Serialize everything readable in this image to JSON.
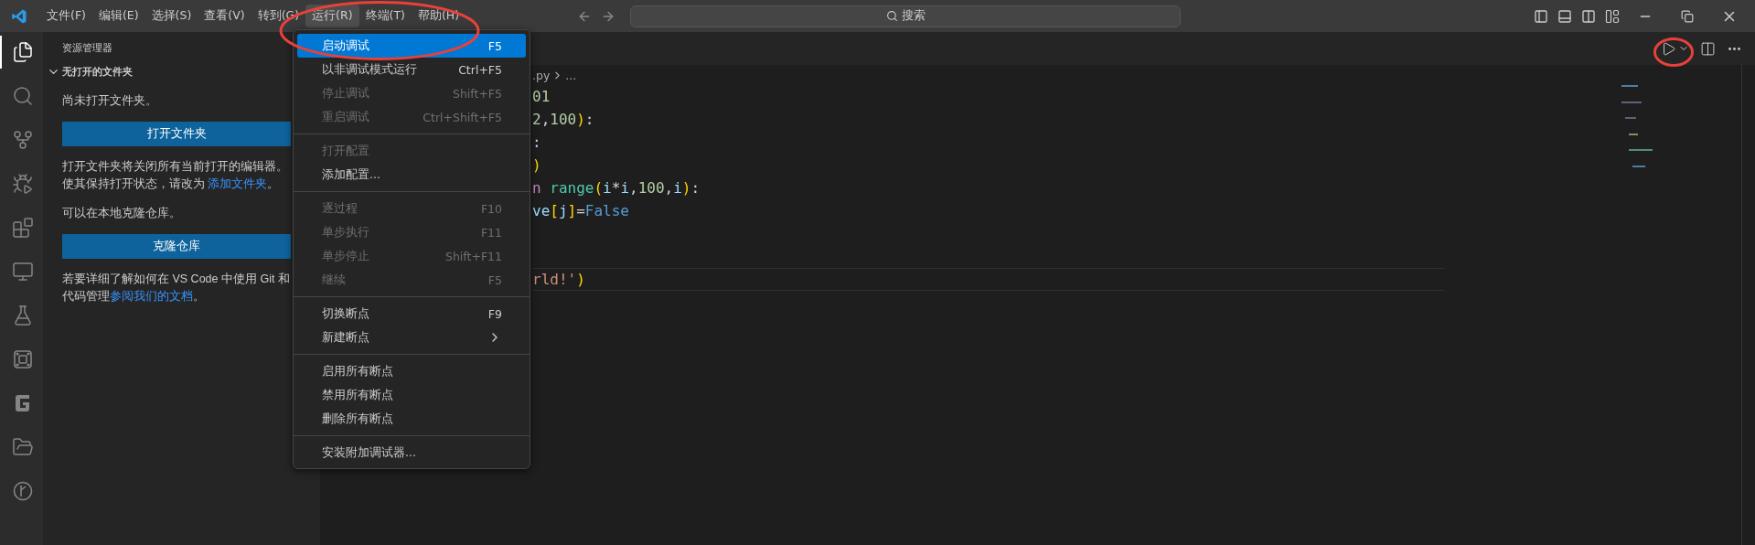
{
  "title_bar": {
    "menus": [
      {
        "label": "文件(F)",
        "selected": false
      },
      {
        "label": "编辑(E)",
        "selected": false
      },
      {
        "label": "选择(S)",
        "selected": false
      },
      {
        "label": "查看(V)",
        "selected": false
      },
      {
        "label": "转到(G)",
        "selected": false
      },
      {
        "label": "运行(R)",
        "selected": true
      },
      {
        "label": "终端(T)",
        "selected": false
      },
      {
        "label": "帮助(H)",
        "selected": false
      }
    ],
    "search": {
      "placeholder": "搜索"
    }
  },
  "activity_bar": {
    "items": [
      {
        "kind": "explorer",
        "selected": true
      },
      {
        "kind": "search",
        "selected": false
      },
      {
        "kind": "source_control",
        "selected": false
      },
      {
        "kind": "run_debug",
        "selected": false
      },
      {
        "kind": "extensions",
        "selected": false
      },
      {
        "kind": "remote",
        "selected": false
      },
      {
        "kind": "testing",
        "selected": false
      },
      {
        "kind": "box",
        "selected": false
      },
      {
        "kind": "g",
        "selected": false
      },
      {
        "kind": "folder",
        "selected": false
      },
      {
        "kind": "git_graph",
        "selected": false
      }
    ]
  },
  "sidebar": {
    "title": "资源管理器",
    "section": {
      "label": "无打开的文件夹",
      "expanded": true
    },
    "empty_text": "尚未打开文件夹。",
    "open_button": "打开文件夹",
    "open_note": {
      "lines": [
        "打开文件夹将关闭所有当前打开的编辑器。",
        "使其保持打开状态，请改为 "
      ],
      "link": "添加文件夹",
      "after": "。"
    },
    "clone_text": "可以在本地克隆仓库。",
    "clone_button": "克隆仓库",
    "git_note": {
      "lines": [
        "若要详细了解如何在 VS Code 中使用 Git 和",
        "代码管理"
      ],
      "link": "参阅我们的文档",
      "after": "。"
    }
  },
  "editor": {
    "breadcrumb": {
      "file": ".py",
      "rest": "..."
    },
    "lines": [
      {
        "current": false,
        "tokens": [
          {
            "text": "01",
            "kind": "number"
          }
        ]
      },
      {
        "current": false,
        "tokens": [
          {
            "text": "2",
            "kind": "number"
          },
          {
            "text": ",",
            "kind": "plain"
          },
          {
            "text": "100",
            "kind": "number"
          },
          {
            "text": ")",
            "kind": "bracket"
          },
          {
            "text": ":",
            "kind": "plain"
          }
        ]
      },
      {
        "current": false,
        "tokens": [
          {
            "text": ":",
            "kind": "plain"
          }
        ]
      },
      {
        "current": false,
        "tokens": [
          {
            "text": ")",
            "kind": "bracket"
          }
        ]
      },
      {
        "current": false,
        "tokens": [
          {
            "text": "n",
            "kind": "keyword"
          },
          {
            "kind": "space"
          },
          {
            "text": "range",
            "kind": "function"
          },
          {
            "text": "(",
            "kind": "bracket"
          },
          {
            "text": "i",
            "kind": "variable"
          },
          {
            "text": "*",
            "kind": "plain"
          },
          {
            "text": "i",
            "kind": "variable"
          },
          {
            "text": ",",
            "kind": "plain"
          },
          {
            "text": "100",
            "kind": "number"
          },
          {
            "text": ",",
            "kind": "plain"
          },
          {
            "text": "i",
            "kind": "variable"
          },
          {
            "text": ")",
            "kind": "bracket"
          },
          {
            "text": ":",
            "kind": "plain"
          }
        ]
      },
      {
        "current": false,
        "tokens": [
          {
            "text": "ve",
            "kind": "variable"
          },
          {
            "text": "[",
            "kind": "bracket"
          },
          {
            "text": "j",
            "kind": "variable"
          },
          {
            "text": "]",
            "kind": "bracket"
          },
          {
            "text": "=",
            "kind": "plain"
          },
          {
            "text": "False",
            "kind": "constant"
          }
        ]
      },
      {
        "current": false
      },
      {
        "current": false
      },
      {
        "current": true,
        "tokens": [
          {
            "text": "rld!'",
            "kind": "string"
          },
          {
            "text": ")",
            "kind": "bracket"
          }
        ]
      }
    ]
  },
  "run_menu": {
    "groups": [
      [
        {
          "label": "启动调试",
          "shortcut": "F5",
          "disabled": false,
          "selected": true,
          "submenu": false
        },
        {
          "label": "以非调试模式运行",
          "shortcut": "Ctrl+F5",
          "disabled": false,
          "selected": false,
          "submenu": false
        },
        {
          "label": "停止调试",
          "shortcut": "Shift+F5",
          "disabled": true,
          "selected": false,
          "submenu": false
        },
        {
          "label": "重启调试",
          "shortcut": "Ctrl+Shift+F5",
          "disabled": true,
          "selected": false,
          "submenu": false
        }
      ],
      [
        {
          "label": "打开配置",
          "disabled": true,
          "selected": false,
          "submenu": false
        },
        {
          "label": "添加配置...",
          "disabled": false,
          "selected": false,
          "submenu": false
        }
      ],
      [
        {
          "label": "逐过程",
          "shortcut": "F10",
          "disabled": true,
          "selected": false,
          "submenu": false
        },
        {
          "label": "单步执行",
          "shortcut": "F11",
          "disabled": true,
          "selected": false,
          "submenu": false
        },
        {
          "label": "单步停止",
          "shortcut": "Shift+F11",
          "disabled": true,
          "selected": false,
          "submenu": false
        },
        {
          "label": "继续",
          "shortcut": "F5",
          "disabled": true,
          "selected": false,
          "submenu": false
        }
      ],
      [
        {
          "label": "切换断点",
          "shortcut": "F9",
          "disabled": false,
          "selected": false,
          "submenu": false
        },
        {
          "label": "新建断点",
          "disabled": false,
          "selected": false,
          "submenu": true
        }
      ],
      [
        {
          "label": "启用所有断点",
          "disabled": false,
          "selected": false,
          "submenu": false
        },
        {
          "label": "禁用所有断点",
          "disabled": false,
          "selected": false,
          "submenu": false
        },
        {
          "label": "删除所有断点",
          "disabled": false,
          "selected": false,
          "submenu": false
        }
      ],
      [
        {
          "label": "安装附加调试器...",
          "disabled": false,
          "selected": false,
          "submenu": false
        }
      ]
    ]
  }
}
